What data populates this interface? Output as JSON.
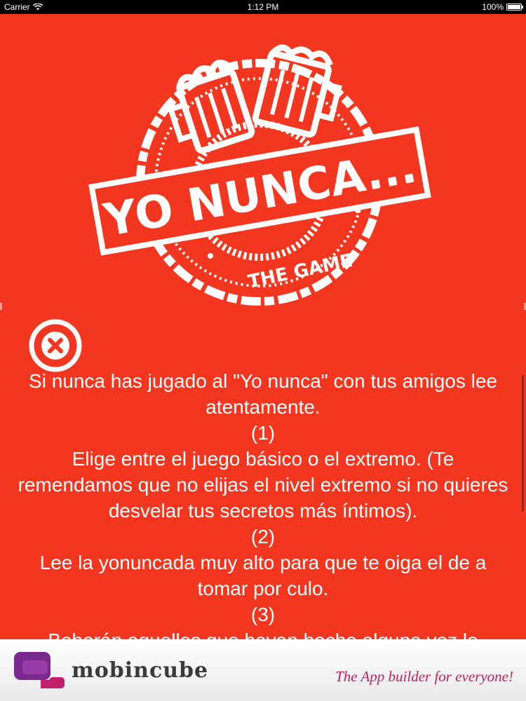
{
  "status_bar": {
    "carrier": "Carrier",
    "time": "1:12 PM",
    "battery": "100%",
    "battery_level": 1.0
  },
  "logo": {
    "title": "YO NUNCA...",
    "subtitle": "THE GAME"
  },
  "close_icon": "close-circle-icon",
  "instructions": [
    "Si nunca has jugado al \"Yo nunca\" con tus amigos lee atentamente.",
    "(1)",
    "Elige entre el juego básico o el extremo. (Te remendamos que no elijas el nivel extremo si no quieres desvelar tus secretos más íntimos).",
    "(2)",
    "Lee la yonuncada muy alto para que te oiga el de a tomar por culo.",
    "(3)",
    "Beberán aquellos que hayan hecho alguna vez lo"
  ],
  "ad": {
    "brand": "mobincube",
    "tagline": "The App builder for everyone!"
  },
  "colors": {
    "background": "#f2361f",
    "text": "#ffffff",
    "tagline": "#c0205a",
    "brand_icon_purple": "#7a2a8c",
    "brand_icon_magenta": "#c21f6a"
  }
}
